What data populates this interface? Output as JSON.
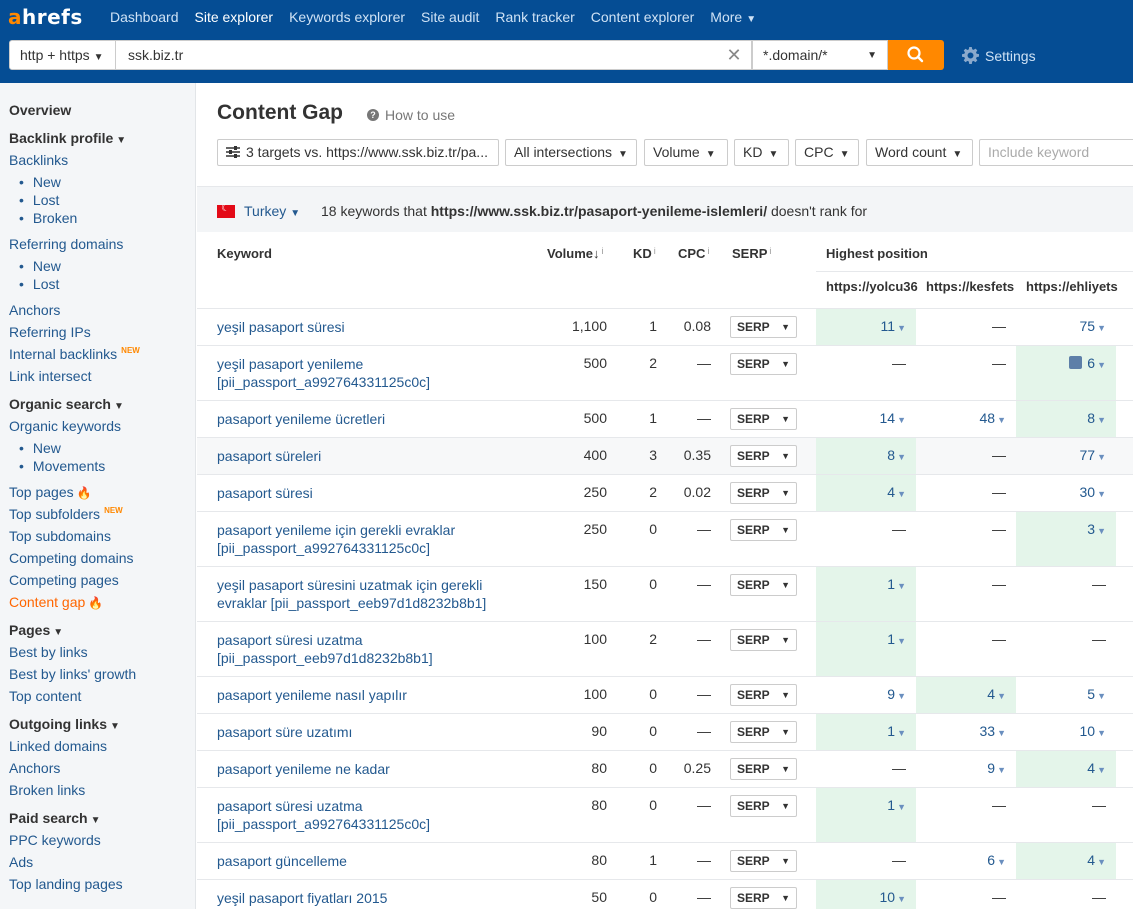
{
  "nav": {
    "logo_a": "a",
    "logo_rest": "hrefs",
    "items": [
      {
        "label": "Dashboard",
        "active": false
      },
      {
        "label": "Site explorer",
        "active": true
      },
      {
        "label": "Keywords explorer",
        "active": false
      },
      {
        "label": "Site audit",
        "active": false
      },
      {
        "label": "Rank tracker",
        "active": false
      },
      {
        "label": "Content explorer",
        "active": false
      },
      {
        "label": "More",
        "active": false
      }
    ]
  },
  "search": {
    "protocol": "http + https",
    "url": "ssk.biz.tr",
    "mode": "*.domain/*",
    "settings_label": "Settings"
  },
  "sidebar": {
    "overview": "Overview",
    "backlink_profile": "Backlink profile",
    "backlinks": "Backlinks",
    "backlinks_new": "New",
    "backlinks_lost": "Lost",
    "backlinks_broken": "Broken",
    "referring_domains": "Referring domains",
    "rd_new": "New",
    "rd_lost": "Lost",
    "anchors": "Anchors",
    "referring_ips": "Referring IPs",
    "internal_backlinks": "Internal backlinks",
    "new_badge": "NEW",
    "link_intersect": "Link intersect",
    "organic_search": "Organic search",
    "organic_keywords": "Organic keywords",
    "ok_new": "New",
    "ok_movements": "Movements",
    "top_pages": "Top pages",
    "top_subfolders": "Top subfolders",
    "top_subdomains": "Top subdomains",
    "competing_domains": "Competing domains",
    "competing_pages": "Competing pages",
    "content_gap": "Content gap",
    "pages": "Pages",
    "best_by_links": "Best by links",
    "best_by_links_growth": "Best by links' growth",
    "top_content": "Top content",
    "outgoing_links": "Outgoing links",
    "linked_domains": "Linked domains",
    "out_anchors": "Anchors",
    "broken_links": "Broken links",
    "paid_search": "Paid search",
    "ppc_keywords": "PPC keywords",
    "ads": "Ads",
    "top_landing_pages": "Top landing pages"
  },
  "page": {
    "title": "Content Gap",
    "how_to_use": "How to use"
  },
  "filters": {
    "targets": "3 targets vs. https://www.ssk.biz.tr/pa...",
    "intersections": "All intersections",
    "volume": "Volume",
    "kd": "KD",
    "cpc": "CPC",
    "word_count": "Word count",
    "include_placeholder": "Include keyword"
  },
  "country": {
    "name": "Turkey",
    "summary_pre": "18 keywords that",
    "summary_url": "https://www.ssk.biz.tr/pasaport-yenileme-islemleri/",
    "summary_post": "doesn't rank for"
  },
  "table": {
    "headers": {
      "keyword": "Keyword",
      "volume": "Volume",
      "kd": "KD",
      "cpc": "CPC",
      "serp": "SERP",
      "highest_position": "Highest position",
      "info": "i"
    },
    "targets": [
      "https://yolcu36",
      "https://kesfets",
      "https://ehliyets"
    ],
    "serp_label": "SERP",
    "rows": [
      {
        "keyword": "yeşil pasaport süresi",
        "volume": "1,100",
        "kd": "1",
        "cpc": "0.08",
        "pos": [
          "11",
          "—",
          "75"
        ],
        "hl": 0
      },
      {
        "keyword": "yeşil pasaport yenileme [pii_passport_a992764331125c0c]",
        "volume": "500",
        "kd": "2",
        "cpc": "—",
        "pos": [
          "—",
          "—",
          "6"
        ],
        "hl": 2
      },
      {
        "keyword": "pasaport yenileme ücretleri",
        "volume": "500",
        "kd": "1",
        "cpc": "—",
        "pos": [
          "14",
          "48",
          "8"
        ],
        "hl": 2
      },
      {
        "keyword": "pasaport süreleri",
        "volume": "400",
        "kd": "3",
        "cpc": "0.35",
        "pos": [
          "8",
          "—",
          "77"
        ],
        "hl": 0
      },
      {
        "keyword": "pasaport süresi",
        "volume": "250",
        "kd": "2",
        "cpc": "0.02",
        "pos": [
          "4",
          "—",
          "30"
        ],
        "hl": 0
      },
      {
        "keyword": "pasaport yenileme için gerekli evraklar [pii_passport_a992764331125c0c]",
        "volume": "250",
        "kd": "0",
        "cpc": "—",
        "pos": [
          "—",
          "—",
          "3"
        ],
        "hl": 2
      },
      {
        "keyword": "yeşil pasaport süresini uzatmak için gerekli evraklar [pii_passport_eeb97d1d8232b8b1]",
        "volume": "150",
        "kd": "0",
        "cpc": "—",
        "pos": [
          "1",
          "—",
          "—"
        ],
        "hl": 0
      },
      {
        "keyword": "pasaport süresi uzatma [pii_passport_eeb97d1d8232b8b1]",
        "volume": "100",
        "kd": "2",
        "cpc": "—",
        "pos": [
          "1",
          "—",
          "—"
        ],
        "hl": 0
      },
      {
        "keyword": "pasaport yenileme nasıl yapılır",
        "volume": "100",
        "kd": "0",
        "cpc": "—",
        "pos": [
          "9",
          "4",
          "5"
        ],
        "hl": 1
      },
      {
        "keyword": "pasaport süre uzatımı",
        "volume": "90",
        "kd": "0",
        "cpc": "—",
        "pos": [
          "1",
          "33",
          "10"
        ],
        "hl": 0
      },
      {
        "keyword": "pasaport yenileme ne kadar",
        "volume": "80",
        "kd": "0",
        "cpc": "0.25",
        "pos": [
          "—",
          "9",
          "4"
        ],
        "hl": 2
      },
      {
        "keyword": "pasaport süresi uzatma [pii_passport_a992764331125c0c]",
        "volume": "80",
        "kd": "0",
        "cpc": "—",
        "pos": [
          "1",
          "—",
          "—"
        ],
        "hl": 0
      },
      {
        "keyword": "pasaport güncelleme",
        "volume": "80",
        "kd": "1",
        "cpc": "—",
        "pos": [
          "—",
          "6",
          "4"
        ],
        "hl": 2
      },
      {
        "keyword": "yeşil pasaport fiyatları 2015",
        "volume": "50",
        "kd": "0",
        "cpc": "—",
        "pos": [
          "10",
          "—",
          "—"
        ],
        "hl": 0
      }
    ]
  }
}
